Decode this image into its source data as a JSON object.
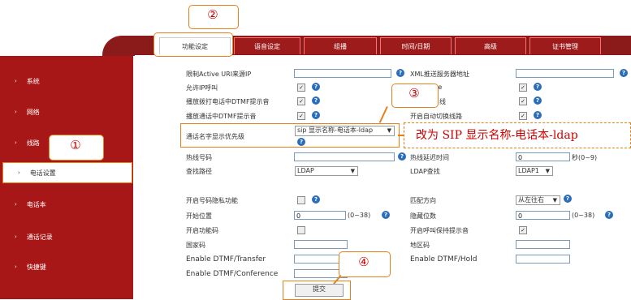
{
  "annotations": {
    "n1": "①",
    "n2": "②",
    "n3": "③",
    "n4": "④",
    "callout": "改为 SIP 显示名称-电话本-ldap"
  },
  "tabs": [
    "功能设定",
    "语音设定",
    "组播",
    "时间/日期",
    "高级",
    "证书管理"
  ],
  "sidebar": [
    "系统",
    "网络",
    "线路",
    "电话设置",
    "电话本",
    "通话记录",
    "快捷键"
  ],
  "form": {
    "restrict_active_uri": "限制Active URI来源IP",
    "xml_push_server": "XML推送服务器地址",
    "allow_ip_call": "允许IP呼叫",
    "hotline_partial": "d Line",
    "dtmf_call_prompt": "播放拨打电话中DTMF提示音",
    "line_partial": "线",
    "dtmf_talk_prompt": "播放通话中DTMF提示音",
    "auto_switch_line": "开启自动切换线路",
    "caller_name_priority": "通话名字显示优先级",
    "caller_name_value": "sip 显示名称-电话本-ldap",
    "hotline_number": "热线号码",
    "hotline_delay": "热线延迟时间",
    "hotline_delay_value": "0",
    "hotline_delay_unit": "秒(0~9)",
    "search_path": "查找路径",
    "search_path_value": "LDAP",
    "ldap_search": "LDAP查找",
    "ldap_search_value": "LDAP1",
    "privacy_number": "开启号码隐私功能",
    "match_direction": "匹配方向",
    "match_direction_value": "从左往右",
    "start_position": "开始位置",
    "start_position_value": "0",
    "start_position_range": "(0~38)",
    "hidden_digits": "隐藏位数",
    "hidden_digits_value": "0",
    "hidden_digits_range": "(0~38)",
    "enable_feature_code": "开启功能码",
    "hold_tone": "开启呼叫保持提示音",
    "country_code": "国家码",
    "area_code": "地区码",
    "dtmf_transfer": "Enable DTMF/Transfer",
    "dtmf_hold": "Enable DTMF/Hold",
    "dtmf_conference": "Enable DTMF/Conference",
    "submit": "提交"
  }
}
